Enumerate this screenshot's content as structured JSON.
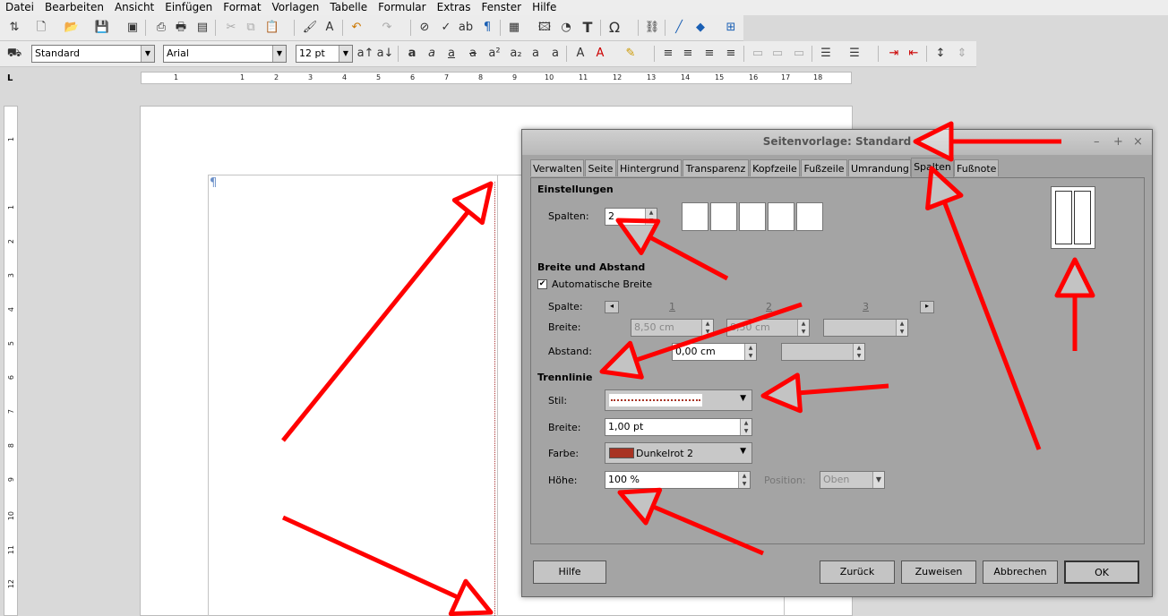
{
  "menu": [
    "Datei",
    "Bearbeiten",
    "Ansicht",
    "Einfügen",
    "Format",
    "Vorlagen",
    "Tabelle",
    "Formular",
    "Extras",
    "Fenster",
    "Hilfe"
  ],
  "toolbar2": {
    "style_value": "Standard",
    "font_value": "Arial",
    "size_value": "12 pt"
  },
  "ruler": {
    "h_numbers": [
      "1",
      "1",
      "2",
      "3",
      "4",
      "5",
      "6",
      "7",
      "8",
      "9",
      "10",
      "11",
      "12",
      "13",
      "14",
      "15",
      "16",
      "17",
      "18"
    ],
    "v_numbers": [
      "1",
      "1",
      "2",
      "3",
      "4",
      "5",
      "6",
      "7",
      "8",
      "9",
      "10",
      "11",
      "12"
    ]
  },
  "document": {
    "pilcrow": "¶"
  },
  "dialog": {
    "title": "Seitenvorlage: Standard",
    "tabs": [
      "Verwalten",
      "Seite",
      "Hintergrund",
      "Transparenz",
      "Kopfzeile",
      "Fußzeile",
      "Umrandung",
      "Spalten",
      "Fußnote"
    ],
    "active_tab": "Spalten",
    "settings": {
      "heading": "Einstellungen",
      "columns_label": "Spalten:",
      "columns_value": "2"
    },
    "width_spacing": {
      "heading": "Breite und Abstand",
      "auto_width_label": "Automatische Breite",
      "auto_width_checked": true,
      "column_label": "Spalte:",
      "column_numbers": [
        "1",
        "2",
        "3"
      ],
      "width_label": "Breite:",
      "width_values": [
        "8,50 cm",
        "8,50 cm",
        ""
      ],
      "spacing_label": "Abstand:",
      "spacing_values": [
        "0,00 cm",
        ""
      ]
    },
    "separator": {
      "heading": "Trennlinie",
      "style_label": "Stil:",
      "width_label": "Breite:",
      "width_value": "1,00 pt",
      "color_label": "Farbe:",
      "color_value": "Dunkelrot 2",
      "color_swatch": "#a83323",
      "height_label": "Höhe:",
      "height_value": "100 %",
      "position_label": "Position:",
      "position_value": "Oben"
    },
    "buttons": {
      "help": "Hilfe",
      "back": "Zurück",
      "apply": "Zuweisen",
      "cancel": "Abbrechen",
      "ok": "OK"
    }
  },
  "annotation_color": "#ff0000"
}
